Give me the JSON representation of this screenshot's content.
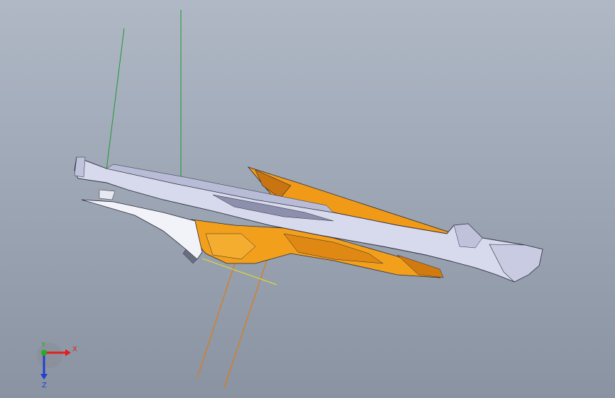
{
  "viewport": {
    "name": "cad-3d-view",
    "background_top": "#b0b8c6",
    "background_bottom": "#8a93a1"
  },
  "model": {
    "primary_color": "#e8900c",
    "secondary_color": "#d6d8ea",
    "edge_color": "#2a2a3a"
  },
  "triad": {
    "x_label": "X",
    "y_label": "Y",
    "z_label": "Z",
    "x_color": "#e02020",
    "y_color": "#20b020",
    "z_color": "#2040d0"
  }
}
